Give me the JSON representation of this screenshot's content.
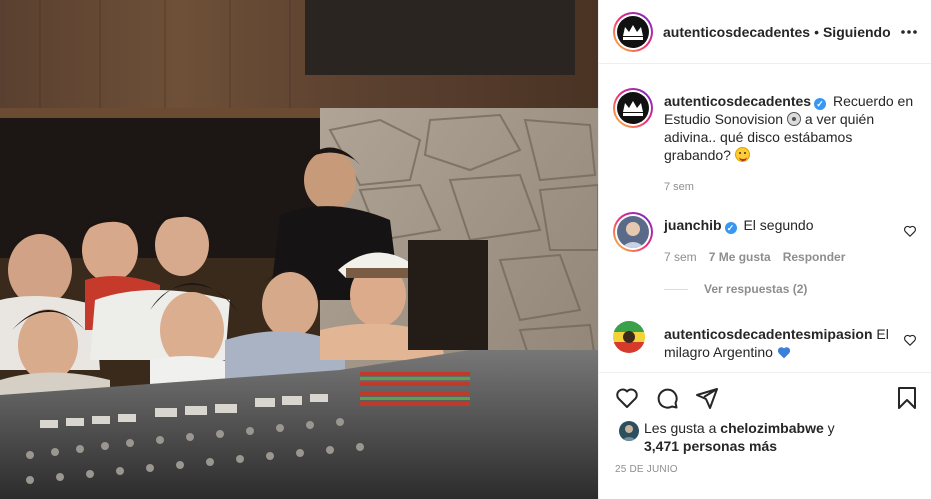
{
  "post": {
    "username": "autenticosdecadentes",
    "follow_status": "Siguiendo",
    "separator": "•",
    "more_icon": "more-options-icon"
  },
  "caption": {
    "username": "autenticosdecadentes",
    "text_part1": "Recuerdo en Estudio Sonovision",
    "text_part2": "a ver quién adivina.. qué disco estábamos grabando?",
    "time": "7 sem"
  },
  "comments": [
    {
      "username": "juanchib",
      "text": "El segundo",
      "time": "7 sem",
      "likes": "7 Me gusta",
      "reply_label": "Responder",
      "view_replies": "Ver respuestas (2)"
    },
    {
      "username": "autenticosdecadentesmipasion",
      "text": "El milagro Argentino"
    }
  ],
  "actions": {
    "like_icon": "heart-icon",
    "comment_icon": "comment-icon",
    "share_icon": "share-icon",
    "save_icon": "bookmark-icon"
  },
  "likes_summary": {
    "prefix": "Les gusta a",
    "user": "chelozimbabwe",
    "conjunction": "y",
    "others": "3,471 personas más"
  },
  "date": "25 DE JUNIO",
  "colors": {
    "verified": "#3897f0",
    "muted": "#8e8e8e",
    "text": "#262626",
    "heart_emoji": "#3b7fd9"
  }
}
